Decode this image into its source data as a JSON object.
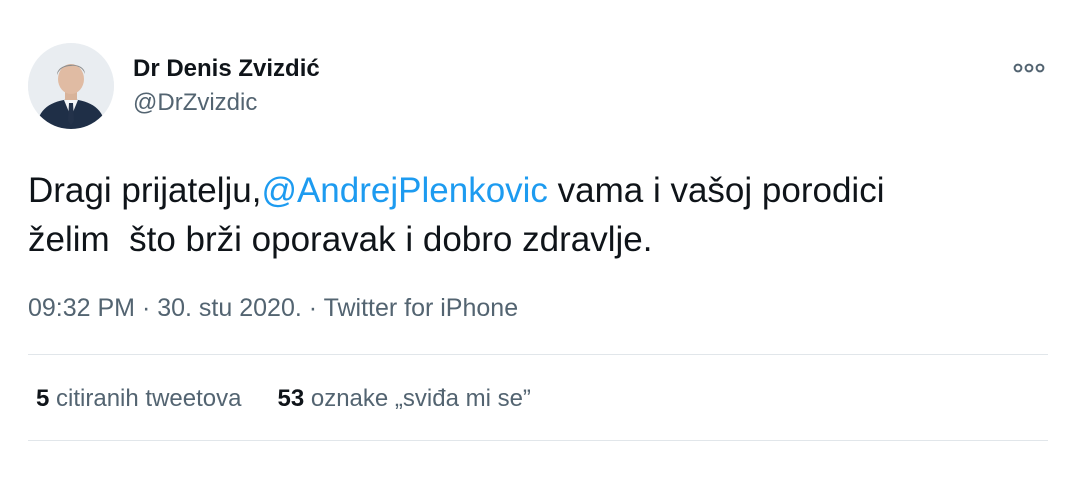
{
  "author": {
    "name": "Dr Denis Zvizdić",
    "handle": "@DrZvizdic",
    "avatar_icon": "profile-photo"
  },
  "tweet": {
    "line1_prefix": "Dragi prijatelju,",
    "mention": "@AndrejPlenkovic",
    "line1_suffix": " vama i vašoj porodici",
    "line2": "želim  što brži oporavak i dobro zdravlje."
  },
  "meta": {
    "time": "09:32 PM",
    "separator": " · ",
    "date": "30. stu 2020.",
    "source": "Twitter for iPhone"
  },
  "stats": {
    "quotes_count": "5",
    "quotes_label": "citiranih tweetova",
    "likes_count": "53",
    "likes_label": "oznake „sviđa mi se”"
  },
  "colors": {
    "link": "#1d9bf0",
    "secondary_text": "#536471",
    "primary_text": "#0f1419"
  },
  "more_icon": "more-horizontal-icon"
}
